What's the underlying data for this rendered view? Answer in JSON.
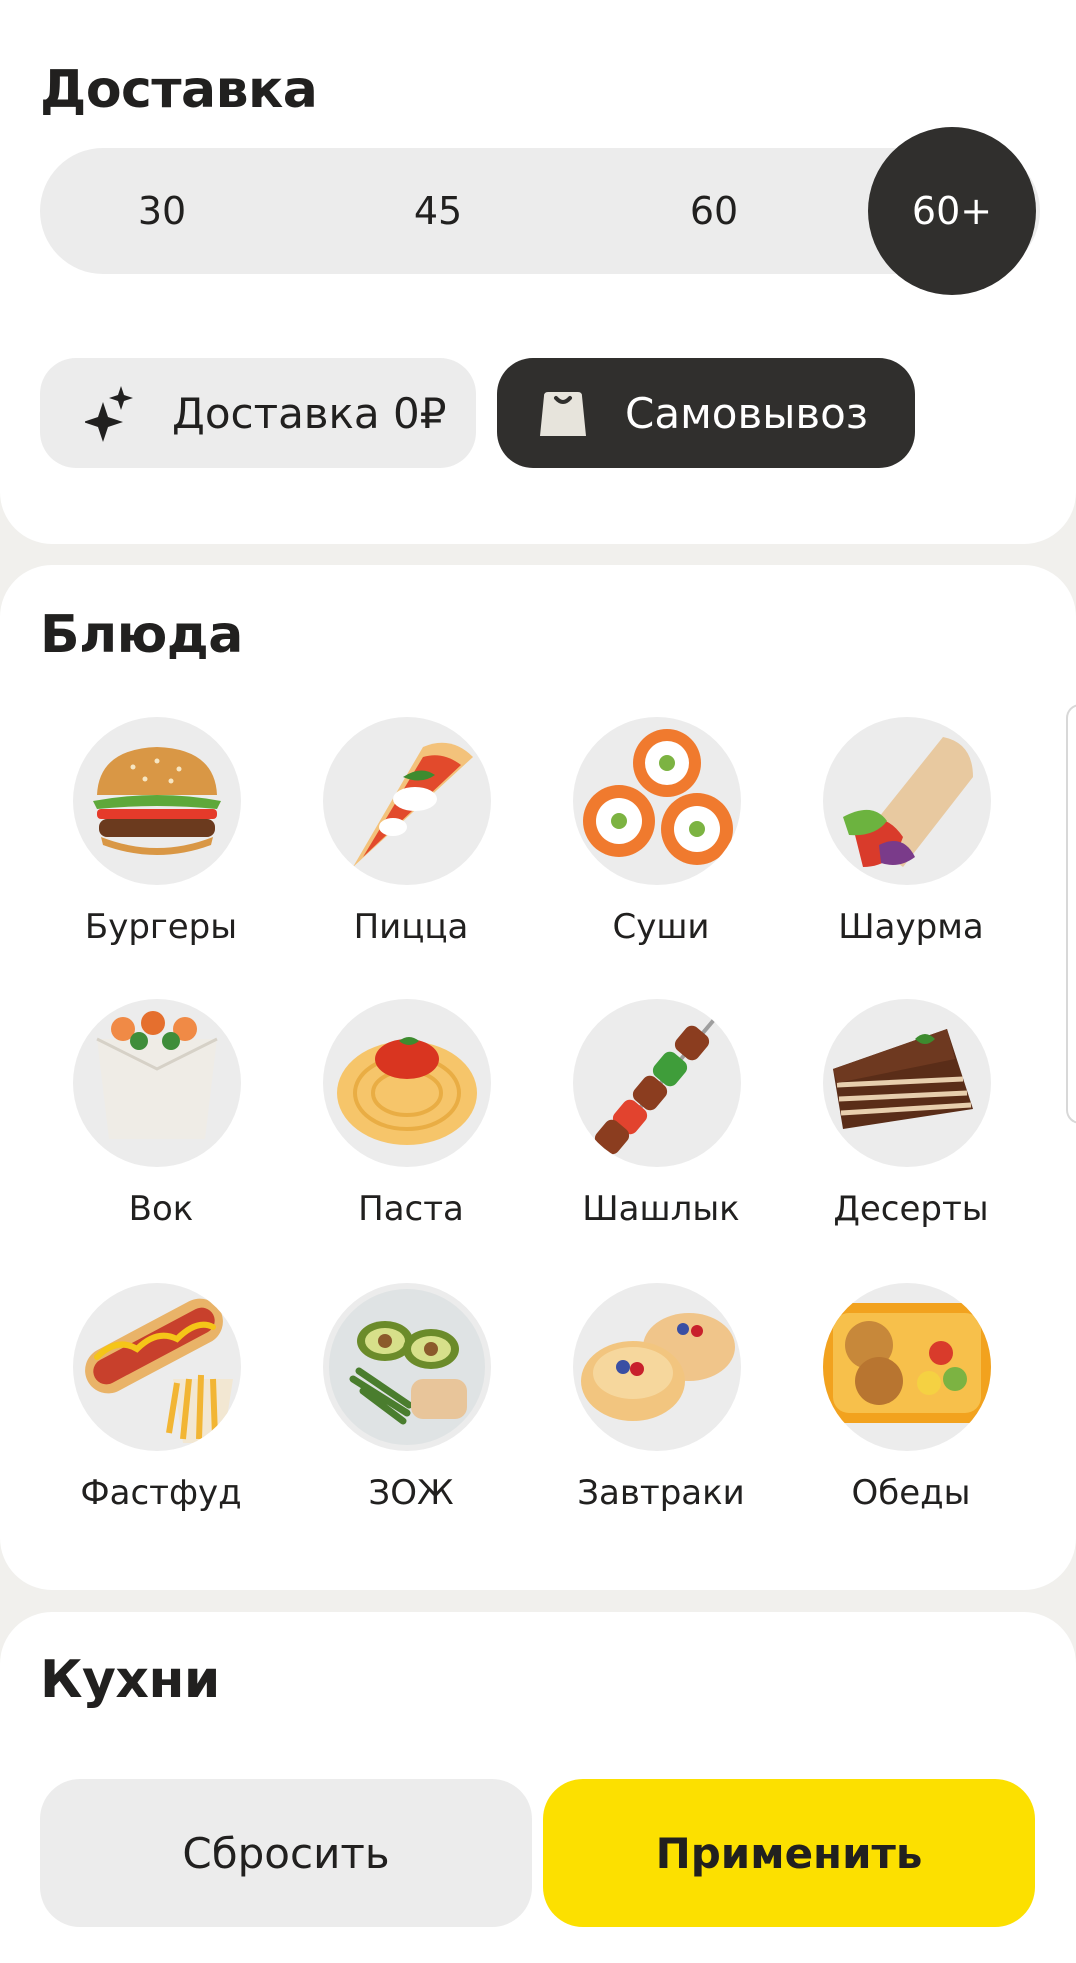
{
  "delivery": {
    "title": "Доставка",
    "time_options": [
      "30",
      "45",
      "60",
      "60+"
    ],
    "selected_time": "60+",
    "filters": {
      "free_delivery": "Доставка 0₽",
      "pickup": "Самовывоз"
    }
  },
  "dishes": {
    "title": "Блюда",
    "items": [
      {
        "label": "Бургеры",
        "icon": "burger"
      },
      {
        "label": "Пицца",
        "icon": "pizza"
      },
      {
        "label": "Суши",
        "icon": "sushi"
      },
      {
        "label": "Шаурма",
        "icon": "shawarma"
      },
      {
        "label": "Вок",
        "icon": "wok"
      },
      {
        "label": "Паста",
        "icon": "pasta"
      },
      {
        "label": "Шашлык",
        "icon": "shashlik"
      },
      {
        "label": "Десерты",
        "icon": "dessert"
      },
      {
        "label": "Фастфуд",
        "icon": "fastfood"
      },
      {
        "label": "ЗОЖ",
        "icon": "healthy"
      },
      {
        "label": "Завтраки",
        "icon": "breakfast"
      },
      {
        "label": "Обеды",
        "icon": "lunch"
      }
    ]
  },
  "kitchens": {
    "title": "Кухни"
  },
  "actions": {
    "reset": "Сбросить",
    "apply": "Применить"
  },
  "colors": {
    "accent": "#fce000",
    "dark": "#302f2d",
    "chip_bg": "#ececec"
  }
}
